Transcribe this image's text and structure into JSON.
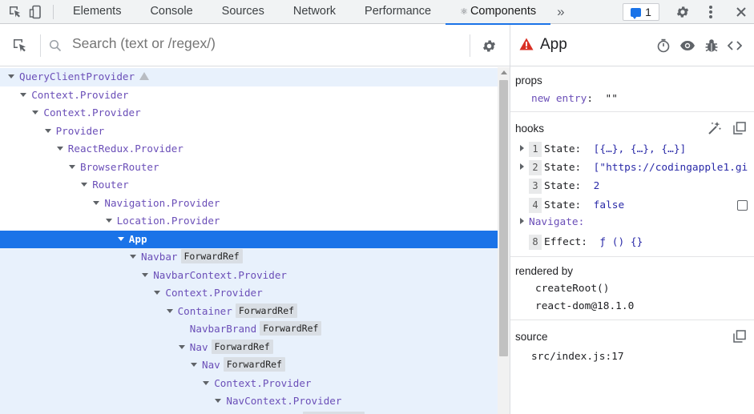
{
  "toolbar": {
    "tabs": [
      {
        "label": "Elements"
      },
      {
        "label": "Console"
      },
      {
        "label": "Sources"
      },
      {
        "label": "Network"
      },
      {
        "label": "Performance"
      },
      {
        "label": "Components",
        "active": true
      }
    ],
    "more_label": "»",
    "issues_count": "1",
    "icons": [
      "inspect-element-icon",
      "device-toolbar-icon",
      "atom-icon",
      "more-tabs-icon",
      "issues-icon",
      "settings-gear-icon",
      "kebab-menu-icon",
      "close-icon"
    ],
    "accent_color": "#1a73e8"
  },
  "search": {
    "placeholder": "Search (text or /regex/)",
    "value": ""
  },
  "tree": {
    "rows": [
      {
        "name": "QueryClientProvider",
        "depth": 0,
        "caret": true,
        "warning": true
      },
      {
        "name": "Context.Provider",
        "depth": 1,
        "caret": true
      },
      {
        "name": "Context.Provider",
        "depth": 2,
        "caret": true
      },
      {
        "name": "Provider",
        "depth": 3,
        "caret": true
      },
      {
        "name": "ReactRedux.Provider",
        "depth": 4,
        "caret": true
      },
      {
        "name": "BrowserRouter",
        "depth": 5,
        "caret": true
      },
      {
        "name": "Router",
        "depth": 6,
        "caret": true
      },
      {
        "name": "Navigation.Provider",
        "depth": 7,
        "caret": true
      },
      {
        "name": "Location.Provider",
        "depth": 8,
        "caret": true
      },
      {
        "name": "App",
        "depth": 9,
        "caret": true,
        "selected": true
      },
      {
        "name": "Navbar",
        "depth": 10,
        "caret": true,
        "badge": "ForwardRef"
      },
      {
        "name": "NavbarContext.Provider",
        "depth": 11,
        "caret": true
      },
      {
        "name": "Context.Provider",
        "depth": 12,
        "caret": true
      },
      {
        "name": "Container",
        "depth": 13,
        "caret": true,
        "badge": "ForwardRef"
      },
      {
        "name": "NavbarBrand",
        "depth": 14,
        "caret": false,
        "badge": "ForwardRef"
      },
      {
        "name": "Nav",
        "depth": 14,
        "caret": true,
        "badge": "ForwardRef"
      },
      {
        "name": "Nav",
        "depth": 15,
        "caret": true,
        "badge": "ForwardRef"
      },
      {
        "name": "Context.Provider",
        "depth": 16,
        "caret": true
      },
      {
        "name": "NavContext.Provider",
        "depth": 17,
        "caret": true
      },
      {
        "name": "",
        "depth": 23,
        "caret": false,
        "badge": "ForwardRef"
      }
    ],
    "selected_color": "#1a73e8",
    "scope_color": "#e8f1fc",
    "name_color": "#6b4fb8"
  },
  "inspector": {
    "title": "App",
    "header_icons": [
      "warning-icon",
      "stopwatch-icon",
      "eye-icon",
      "bug-icon",
      "view-source-icon"
    ],
    "props": {
      "title": "props",
      "items": [
        {
          "key": "new entry",
          "value": "\"\""
        }
      ]
    },
    "hooks": {
      "title": "hooks",
      "items": [
        {
          "index": "1",
          "name": "State:",
          "value": "[{…}, {…}, {…}]",
          "caret": true
        },
        {
          "index": "2",
          "name": "State:",
          "value": "[\"https://codingapple1.gi",
          "caret": true
        },
        {
          "index": "3",
          "name": "State:",
          "value": "2",
          "caret": false
        },
        {
          "index": "4",
          "name": "State:",
          "value": "false",
          "caret": false,
          "checkbox": true
        },
        {
          "index": "",
          "name": "Navigate:",
          "value": "",
          "caret": true
        },
        {
          "index": "8",
          "name": "Effect:",
          "value": "ƒ () {}",
          "caret": false
        }
      ]
    },
    "rendered_by": {
      "title": "rendered by",
      "items": [
        "createRoot()",
        "react-dom@18.1.0"
      ]
    },
    "source": {
      "title": "source",
      "value": "src/index.js:17"
    }
  }
}
